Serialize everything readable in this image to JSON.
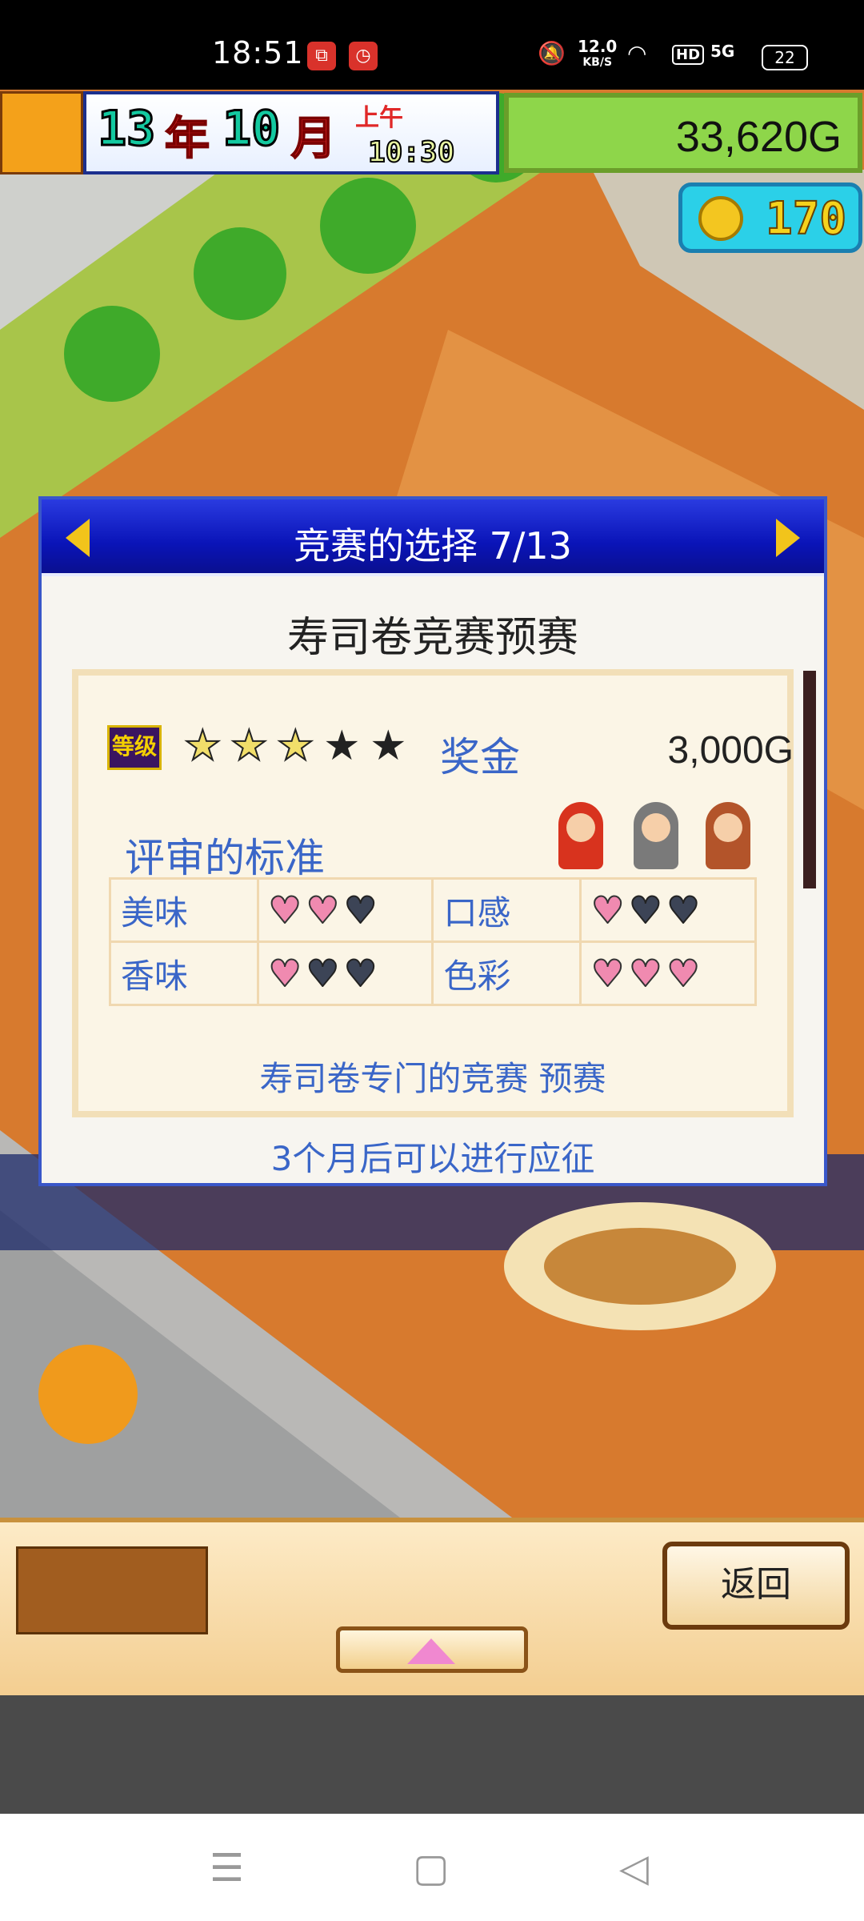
{
  "status_bar": {
    "time": "18:51",
    "net_speed_value": "12.0",
    "net_speed_unit": "KB/S",
    "hd_label": "HD",
    "signal_label": "5G",
    "battery": "22"
  },
  "hud": {
    "year": "13",
    "year_char": "年",
    "month": "10",
    "month_char": "月",
    "ampm": "上午",
    "clock": "10:30",
    "money": "33,620G",
    "coins": "170"
  },
  "dialog": {
    "title": "竞赛的选择 7/13",
    "contest_name": "寿司卷竞赛预赛",
    "rank_label": "等级",
    "rank_stars": 2.5,
    "rank_max": 5,
    "prize_label": "奖金",
    "prize_value": "3,000G",
    "criteria_title": "评审的标准",
    "criteria": [
      {
        "label": "美味",
        "hearts": 2,
        "max": 3
      },
      {
        "label": "口感",
        "hearts": 1,
        "max": 3
      },
      {
        "label": "香味",
        "hearts": 1,
        "max": 3
      },
      {
        "label": "色彩",
        "hearts": 3,
        "max": 3
      }
    ],
    "description": "寿司卷专门的竞赛 预赛",
    "note": "3个月后可以进行应征"
  },
  "bottom": {
    "back_label": "返回"
  },
  "colors": {
    "dialog_header": "#0a14b8",
    "accent_text": "#3a66c8",
    "heart_on": "#f08ab0",
    "heart_off": "#3c4456"
  }
}
